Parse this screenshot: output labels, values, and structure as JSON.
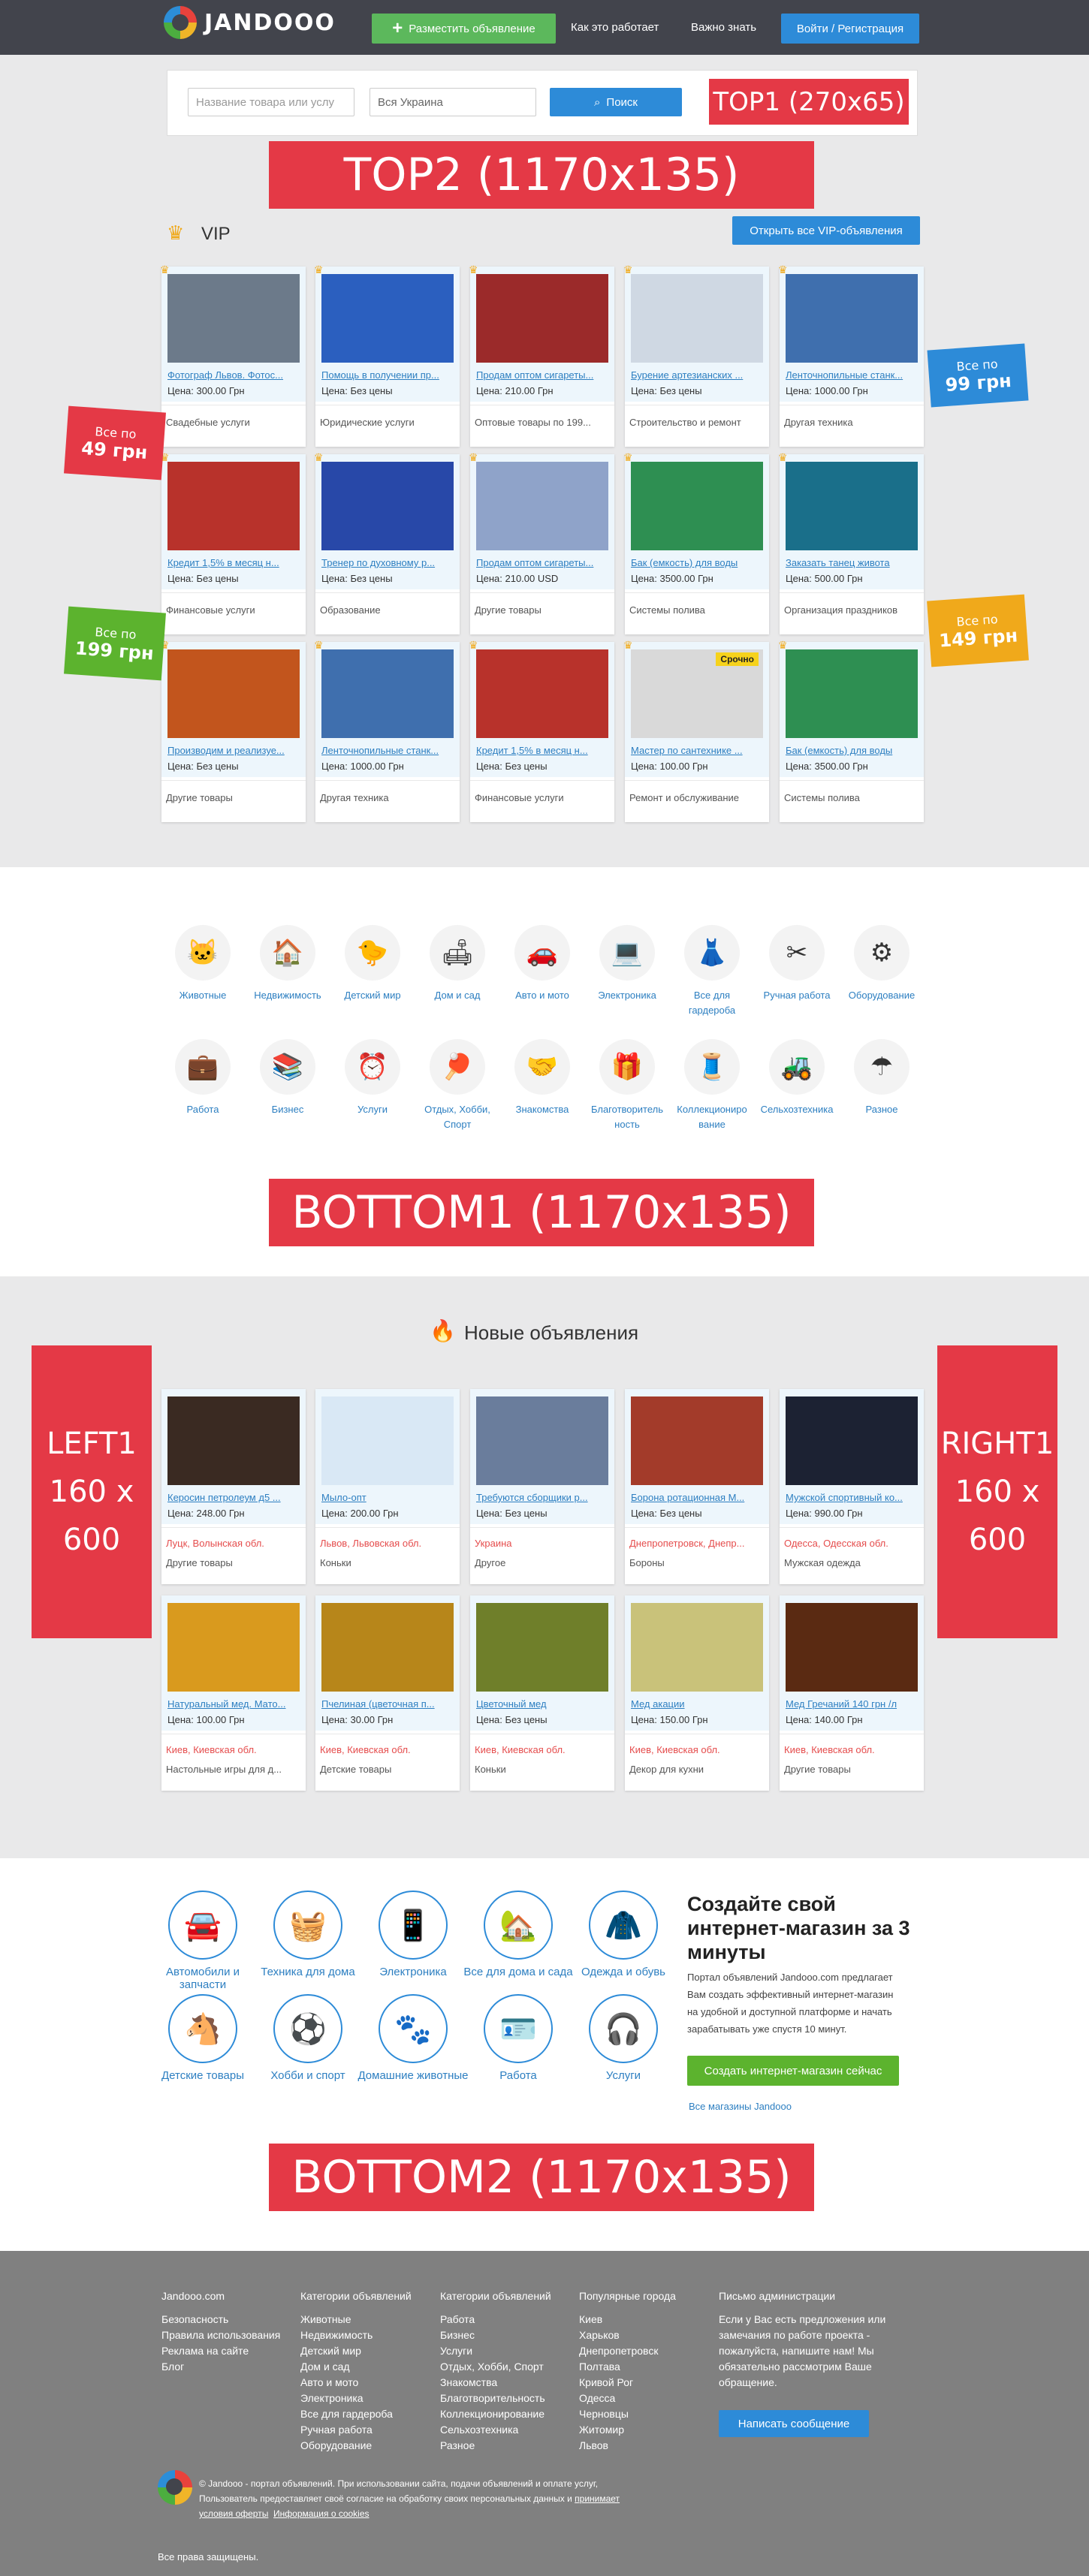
{
  "header": {
    "logo": "JANDOOO",
    "post_button": "Разместить объявление",
    "nav": [
      "Как это работает",
      "Важно знать"
    ],
    "login_button": "Войти / Регистрация"
  },
  "search": {
    "product_placeholder": "Название товара или услу",
    "region_value": "Вся Украина",
    "button": "Поиск"
  },
  "banners": {
    "top1": "TOP1 (270x65)",
    "top2": "TOP2 (1170x135)",
    "bottom1": "BOTTOM1 (1170x135)",
    "bottom2": "BOTTOM2 (1170x135)",
    "left1": [
      "LEFT1",
      "160 x",
      "600"
    ],
    "right1": [
      "RIGHT1",
      "160 x",
      "600"
    ]
  },
  "vip": {
    "title": "VIP",
    "open_all": "Открыть все VIP-объявления",
    "flags": [
      {
        "small": "Все по",
        "big": "49 грн",
        "color": "#e43946"
      },
      {
        "small": "Все по",
        "big": "99 грн",
        "color": "#2d8bd8"
      },
      {
        "small": "Все по",
        "big": "199 грн",
        "color": "#5cb32e"
      },
      {
        "small": "Все по",
        "big": "149 грн",
        "color": "#f0a91b"
      }
    ],
    "rows": [
      [
        {
          "t": "Фотограф Львов. Фотос...",
          "p": "Цена: 300.00 Грн",
          "c": "Свадебные услуги",
          "col": "#6c7a8a"
        },
        {
          "t": "Помощь в получении пр...",
          "p": "Цена: Без цены",
          "c": "Юридические услуги",
          "col": "#2b5fbf"
        },
        {
          "t": "Продам оптом сигареты...",
          "p": "Цена: 210.00 Грн",
          "c": "Оптовые товары по 199...",
          "col": "#9b2a2a"
        },
        {
          "t": "Бурение артезианских ...",
          "p": "Цена: Без цены",
          "c": "Строительство и ремонт",
          "col": "#cfd8e3"
        },
        {
          "t": "Ленточнопильные станк...",
          "p": "Цена: 1000.00 Грн",
          "c": "Другая техника",
          "col": "#3f6fae"
        }
      ],
      [
        {
          "t": "Кредит 1,5% в месяц н...",
          "p": "Цена: Без цены",
          "c": "Финансовые услуги",
          "col": "#b8322b"
        },
        {
          "t": "Тренер по духовному р...",
          "p": "Цена: Без цены",
          "c": "Образование",
          "col": "#2848a8"
        },
        {
          "t": "Продам оптом сигареты...",
          "p": "Цена: 210.00 USD",
          "c": "Другие товары",
          "col": "#8fa3c9"
        },
        {
          "t": "Бак (емкость) для воды",
          "p": "Цена: 3500.00 Грн",
          "c": "Системы полива",
          "col": "#2e8f52"
        },
        {
          "t": "Заказать танец живота",
          "p": "Цена: 500.00 Грн",
          "c": "Организация праздников",
          "col": "#1a6f8a"
        }
      ],
      [
        {
          "t": "Производим и реализуе...",
          "p": "Цена: Без цены",
          "c": "Другие товары",
          "col": "#c2551d"
        },
        {
          "t": "Ленточнопильные станк...",
          "p": "Цена: 1000.00 Грн",
          "c": "Другая техника",
          "col": "#3f6fae"
        },
        {
          "t": "Кредит 1,5% в месяц н...",
          "p": "Цена: Без цены",
          "c": "Финансовые услуги",
          "col": "#b8322b"
        },
        {
          "t": "Мастер по сантехнике ...",
          "p": "Цена: 100.00 Грн",
          "c": "Ремонт и обслуживание",
          "col": "#d9d9d9",
          "badge": "Срочно"
        },
        {
          "t": "Бак (емкость) для воды",
          "p": "Цена: 3500.00 Грн",
          "c": "Системы полива",
          "col": "#2e8f52"
        }
      ]
    ]
  },
  "categories": [
    {
      "l": "Животные",
      "i": "🐱"
    },
    {
      "l": "Недвижимость",
      "i": "🏠"
    },
    {
      "l": "Детский мир",
      "i": "🐤"
    },
    {
      "l": "Дом и сад",
      "i": "🛋"
    },
    {
      "l": "Авто и мото",
      "i": "🚗"
    },
    {
      "l": "Электроника",
      "i": "💻"
    },
    {
      "l": "Все для гардероба",
      "i": "👗"
    },
    {
      "l": "Ручная работа",
      "i": "✂"
    },
    {
      "l": "Оборудование",
      "i": "⚙"
    },
    {
      "l": "Работа",
      "i": "💼"
    },
    {
      "l": "Бизнес",
      "i": "📚"
    },
    {
      "l": "Услуги",
      "i": "⏰"
    },
    {
      "l": "Отдых, Хобби, Спорт",
      "i": "🏓"
    },
    {
      "l": "Знакомства",
      "i": "🤝"
    },
    {
      "l": "Благотворитель ность",
      "i": "🎁"
    },
    {
      "l": "Коллекциониро вание",
      "i": "🧵"
    },
    {
      "l": "Сельхозтехника",
      "i": "🚜"
    },
    {
      "l": "Разное",
      "i": "☂"
    }
  ],
  "new_ads": {
    "title": "Новые объявления",
    "rows": [
      [
        {
          "t": "Керосин петролеум д5 ...",
          "p": "Цена: 248.00 Грн",
          "loc": "Луцк, Волынская обл.",
          "c": "Другие товары",
          "col": "#3a2a22"
        },
        {
          "t": "Мыло-опт",
          "p": "Цена: 200.00 Грн",
          "loc": "Львов, Львовская обл.",
          "c": "Коньки",
          "col": "#d9e8f5"
        },
        {
          "t": "Требуются сборщики р...",
          "p": "Цена: Без цены",
          "loc": "Украина",
          "c": "Другое",
          "col": "#6a7d9c"
        },
        {
          "t": "Борона ротационная М...",
          "p": "Цена: Без цены",
          "loc": "Днепропетровск, Днепр...",
          "c": "Бороны",
          "col": "#a33b2a"
        },
        {
          "t": "Мужской спортивный ко...",
          "p": "Цена: 990.00 Грн",
          "loc": "Одесса, Одесская обл.",
          "c": "Мужская одежда",
          "col": "#1c2233"
        }
      ],
      [
        {
          "t": "Натуральный мед. Мато...",
          "p": "Цена: 100.00 Грн",
          "loc": "Киев, Киевская обл.",
          "c": "Настольные игры для д...",
          "col": "#d99a1e"
        },
        {
          "t": "Пчелиная (цветочная п...",
          "p": "Цена: 30.00 Грн",
          "loc": "Киев, Киевская обл.",
          "c": "Детские товары",
          "col": "#b7861a"
        },
        {
          "t": "Цветочный мед",
          "p": "Цена: Без цены",
          "loc": "Киев, Киевская обл.",
          "c": "Коньки",
          "col": "#6f7f2a"
        },
        {
          "t": "Мед акации",
          "p": "Цена: 150.00 Грн",
          "loc": "Киев, Киевская обл.",
          "c": "Декор для кухни",
          "col": "#c9c27a"
        },
        {
          "t": "Мед Гречаний 140 грн /л",
          "p": "Цена: 140.00 Грн",
          "loc": "Киев, Киевская обл.",
          "c": "Другие товары",
          "col": "#5a2a12"
        }
      ]
    ]
  },
  "shop_categories": [
    {
      "l": "Автомобили и запчасти",
      "i": "🚘"
    },
    {
      "l": "Техника для дома",
      "i": "🧺"
    },
    {
      "l": "Электроника",
      "i": "📱"
    },
    {
      "l": "Все для дома и сада",
      "i": "🏡"
    },
    {
      "l": "Одежда и обувь",
      "i": "🧥"
    },
    {
      "l": "Детские товары",
      "i": "🐴"
    },
    {
      "l": "Хобби и спорт",
      "i": "⚽"
    },
    {
      "l": "Домашние животные",
      "i": "🐾"
    },
    {
      "l": "Работа",
      "i": "🪪"
    },
    {
      "l": "Услуги",
      "i": "🎧"
    }
  ],
  "shop_promo": {
    "title": "Создайте свой интернет-магазин за 3 минуты",
    "text": "Портал объявлений Jandooo.com предлагает Вам создать эффективный интернет-магазин на удобной и доступной платформе и начать зарабатывать уже спустя 10 минут.",
    "button": "Создать интернет-магазин сейчас",
    "all_link": "Все магазины Jandooo"
  },
  "footer": {
    "cols": [
      {
        "h": "Jandooo.com",
        "items": [
          "Безопасность",
          "Правила использования",
          "Реклама на сайте",
          "Блог"
        ]
      },
      {
        "h": "Категории объявлений",
        "items": [
          "Животные",
          "Недвижимость",
          "Детский мир",
          "Дом и сад",
          "Авто и мото",
          "Электроника",
          "Все для гардероба",
          "Ручная работа",
          "Оборудование"
        ]
      },
      {
        "h": "Категории объявлений",
        "items": [
          "Работа",
          "Бизнес",
          "Услуги",
          "Отдых, Хобби, Спорт",
          "Знакомства",
          "Благотворительность",
          "Коллекционирование",
          "Сельхозтехника",
          "Разное"
        ]
      },
      {
        "h": "Популярные города",
        "items": [
          "Киев",
          "Харьков",
          "Днепропетровск",
          "Полтава",
          "Кривой Рог",
          "Одесса",
          "Черновцы",
          "Житомир",
          "Львов"
        ]
      }
    ],
    "admin": {
      "h": "Письмо администрации",
      "text": "Если у Вас есть предложения или замечания по работе проекта - пожалуйста, напишите нам! Мы обязательно рассмотрим Ваше обращение.",
      "button": "Написать сообщение"
    },
    "legal1": "© Jandooo - портал объявлений. При использовании сайта, подачи объявлений и оплате услуг,",
    "legal2": "Пользователь предоставляет своё согласие на обработку своих персональных данных и",
    "legal_accept": "принимает",
    "legal3": "условия оферты",
    "legal_info": "Информация о cookies",
    "rights": "Все права защищены."
  }
}
